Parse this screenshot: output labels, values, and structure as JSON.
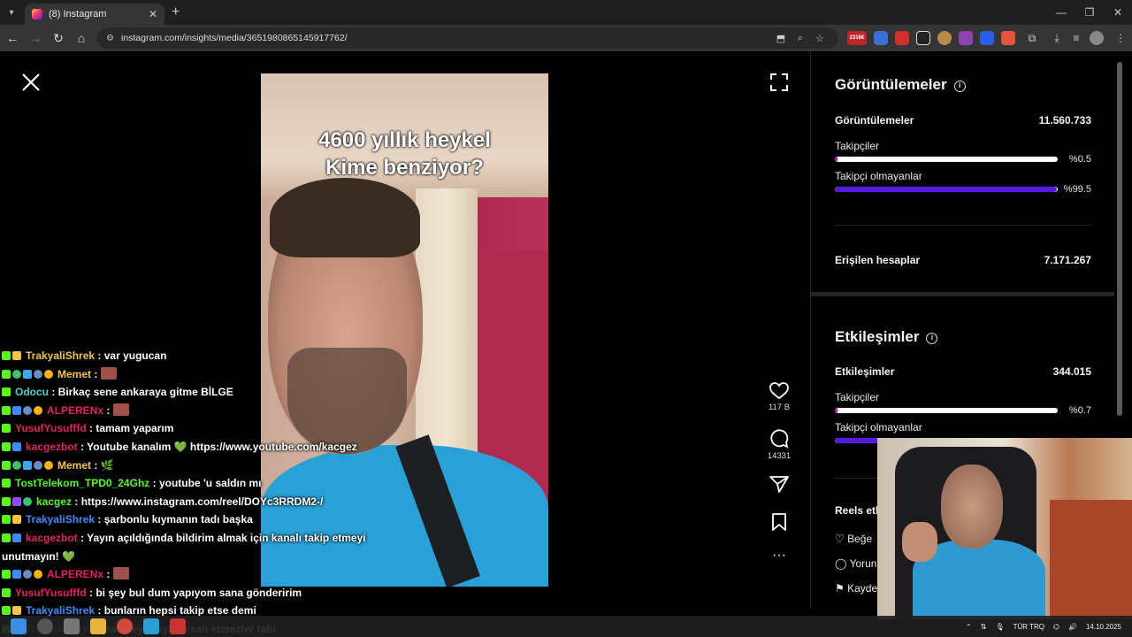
{
  "browser": {
    "tab_title": "(8) Instagram",
    "url": "instagram.com/insights/media/3651980865145917762/",
    "ext_badge": "2316€"
  },
  "video": {
    "caption_line1": "4600 yıllık heykel",
    "caption_line2": "Kime benziyor?"
  },
  "actions": {
    "like_count": "117 B",
    "comment_count": "14331"
  },
  "chat": [
    {
      "user": "TrakyaliShrek",
      "user_color": "#f4c542",
      "text": ": var yugucan",
      "badges": [
        "kick",
        "crown"
      ],
      "emote": false
    },
    {
      "user": "Memet",
      "user_color": "#f4c542",
      "text": ":",
      "badges": [
        "kick",
        "check",
        "cube",
        "circle",
        "one"
      ],
      "emote": true
    },
    {
      "user": "Odocu",
      "user_color": "#4fd1c5",
      "text": ": Birkaç sene ankaraya gitme BİLGE",
      "badges": [
        "kick"
      ],
      "emote": false
    },
    {
      "user": "ALPERENx",
      "user_color": "#e0245e",
      "text": ":",
      "badges": [
        "kick",
        "shield",
        "circle",
        "one"
      ],
      "emote": true
    },
    {
      "user": "YusufYusufffd",
      "user_color": "#e0245e",
      "text": ": tamam yaparım",
      "badges": [
        "kick"
      ],
      "emote": false
    },
    {
      "user": "kacgezbot",
      "user_color": "#e0245e",
      "text": ": Youtube kanalım 💚 https://www.youtube.com/kacgez",
      "badges": [
        "kick",
        "shield"
      ],
      "emote": false
    },
    {
      "user": "Memet",
      "user_color": "#f4c542",
      "text": ": 🌿",
      "badges": [
        "kick",
        "check",
        "cube",
        "circle",
        "one"
      ],
      "emote": false
    },
    {
      "user": "TostTelekom_TPD0_24Ghz",
      "user_color": "#53fc18",
      "text": ": youtube 'u saldın mı",
      "badges": [
        "kick"
      ],
      "emote": false
    },
    {
      "user": "kacgez",
      "user_color": "#53fc18",
      "text": ": https://www.instagram.com/reel/DOYc3RRDM2-/",
      "badges": [
        "kick",
        "mic",
        "check"
      ],
      "emote": false
    },
    {
      "user": "TrakyaliShrek",
      "user_color": "#3d8bff",
      "text": ": şarbonlu kıymanın tadı başka",
      "badges": [
        "kick",
        "crown"
      ],
      "emote": false
    },
    {
      "user": "kacgezbot",
      "user_color": "#e0245e",
      "text": ": Yayın açıldığında bildirim almak için kanalı takip etmeyi",
      "badges": [
        "kick",
        "shield"
      ],
      "emote": false
    },
    {
      "user": "",
      "user_color": "#ffffff",
      "text": "unutmayın! 💚",
      "badges": [],
      "emote": false
    },
    {
      "user": "ALPERENx",
      "user_color": "#e0245e",
      "text": ":",
      "badges": [
        "kick",
        "shield",
        "circle",
        "one"
      ],
      "emote": true
    },
    {
      "user": "YusufYusufffd",
      "user_color": "#e0245e",
      "text": ": bi şey bul dum yapıyom sana gönderirim",
      "badges": [
        "kick"
      ],
      "emote": false
    },
    {
      "user": "TrakyaliShrek",
      "user_color": "#3d8bff",
      "text": ": bunların hepsi takip etse demi",
      "badges": [
        "kick",
        "crown"
      ],
      "emote": false
    },
    {
      "user": "TrakyaliShrek",
      "user_color": "#3d8bff",
      "text": ": hadiseyi paylaşırsan etmezler tabi",
      "badges": [
        "kick",
        "crown"
      ],
      "emote": false
    }
  ],
  "insights": {
    "views": {
      "title": "Görüntülemeler",
      "total_label": "Görüntülemeler",
      "total_value": "11.560.733",
      "followers_label": "Takipçiler",
      "followers_pct": "%0.5",
      "followers_fraction": 0.005,
      "followers_color": "#d300c5",
      "nonfollowers_label": "Takipçi olmayanlar",
      "nonfollowers_pct": "%99.5",
      "nonfollowers_fraction": 0.995,
      "nonfollowers_color": "#5c1bdb",
      "reach_label": "Erişilen hesaplar",
      "reach_value": "7.171.267"
    },
    "engagement": {
      "title": "Etkileşimler",
      "total_label": "Etkileşimler",
      "total_value": "344.015",
      "followers_label": "Takipçiler",
      "followers_pct": "%0.7",
      "followers_fraction": 0.007,
      "nonfollowers_label": "Takipçi olmayanlar",
      "reels_title": "Reels etk",
      "reels_items": [
        "Beğe",
        "Yorun",
        "Kayde"
      ]
    }
  },
  "taskbar": {
    "lang": "TÜR TRQ",
    "date": "14.10.2025"
  }
}
